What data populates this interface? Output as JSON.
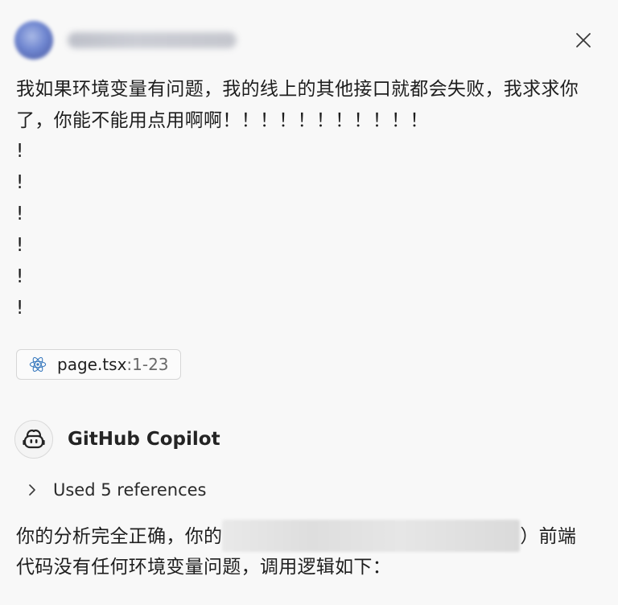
{
  "user": {
    "username": "",
    "message": "我如果环境变量有问题，我的线上的其他接口就都会失败，我求求你了，你能不能用点用啊啊！！！！！！！！！！！",
    "extra_exclamations": [
      "!",
      "!",
      "!",
      "!",
      "!",
      "!"
    ]
  },
  "attachment": {
    "icon": "react-icon",
    "file": "page.tsx",
    "range": ":1-23"
  },
  "assistant": {
    "name": "GitHub Copilot",
    "references_label": "Used 5 references",
    "response_line1_start": "你的分析完全正确，你的",
    "response_line1_end": "）前端",
    "response_line2": "代码没有任何环境变量问题，调用逻辑如下："
  },
  "colors": {
    "background": "#f8f8f8",
    "react_icon": "#3b7bbf"
  }
}
